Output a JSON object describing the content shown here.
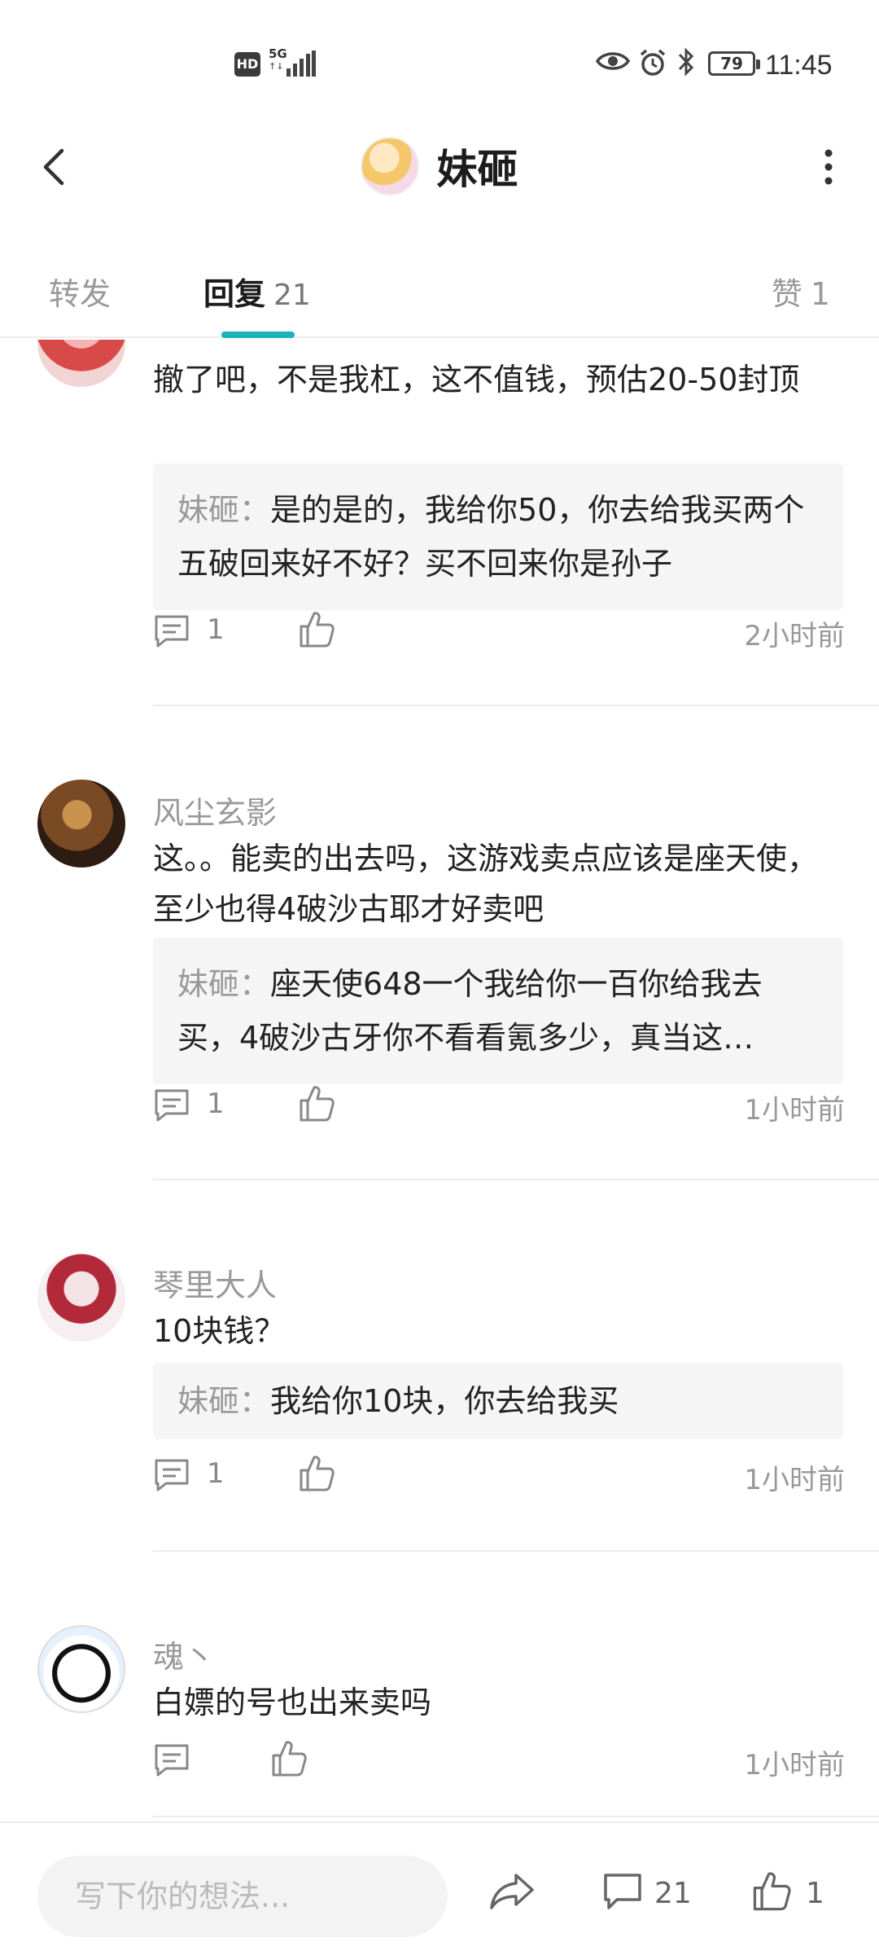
{
  "status_bar": {
    "hd": "HD",
    "network": "5G",
    "battery": "79",
    "time": "11:45"
  },
  "header": {
    "title": "妹砸"
  },
  "tabs": {
    "forward": "转发",
    "reply_label": "回复",
    "reply_count": "21",
    "likes_label": "赞",
    "likes_count": "1"
  },
  "comments": [
    {
      "author": "",
      "text": "撤了吧，不是我杠，这不值钱，预估20-50封顶",
      "reply_name": "妹砸：",
      "reply_text": "是的是的，我给你50，你去给我买两个五破回来好不好？买不回来你是孙子",
      "comment_count": "1",
      "time": "2小时前"
    },
    {
      "author": "风尘玄影",
      "text": "这。。能卖的出去吗，这游戏卖点应该是座天使，至少也得4破沙古耶才好卖吧",
      "reply_name": "妹砸：",
      "reply_line1": "座天使648一个我给你一百你给我去",
      "reply_line2": "买，4破沙古牙你不看看氪多少，真当这…",
      "comment_count": "1",
      "time": "1小时前"
    },
    {
      "author": "琴里大人",
      "text": "10块钱？",
      "reply_name": "妹砸：",
      "reply_text": "我给你10块，你去给我买",
      "comment_count": "1",
      "time": "1小时前"
    },
    {
      "author": "魂丶",
      "text": "白嫖的号也出来卖吗",
      "comment_count": "",
      "time": "1小时前"
    }
  ],
  "bottom_bar": {
    "placeholder": "写下你的想法...",
    "comment_count": "21",
    "like_count": "1"
  },
  "icons": {
    "back": "back-arrow-icon",
    "more": "more-vertical-icon",
    "comment": "comment-icon",
    "like": "thumbs-up-icon",
    "share": "share-icon"
  }
}
